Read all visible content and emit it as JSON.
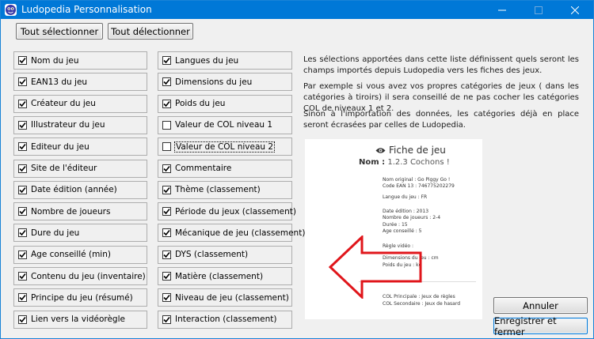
{
  "window": {
    "title": "Ludopedia Personnalisation"
  },
  "toolbar": {
    "select_all": "Tout sélectionner",
    "deselect_all": "Tout délectionner"
  },
  "fields_left": [
    {
      "label": "Nom du jeu",
      "checked": true
    },
    {
      "label": "EAN13 du jeu",
      "checked": true
    },
    {
      "label": "Créateur du jeu",
      "checked": true
    },
    {
      "label": "Illustrateur du jeu",
      "checked": true
    },
    {
      "label": "Editeur du jeu",
      "checked": true
    },
    {
      "label": "Site de l'éditeur",
      "checked": true
    },
    {
      "label": "Date édition (année)",
      "checked": true
    },
    {
      "label": "Nombre de joueurs",
      "checked": true
    },
    {
      "label": "Dure du jeu",
      "checked": true
    },
    {
      "label": "Age conseillé (min)",
      "checked": true
    },
    {
      "label": "Contenu du jeu (inventaire)",
      "checked": true
    },
    {
      "label": "Principe du jeu (résumé)",
      "checked": true
    },
    {
      "label": "Lien vers la vidéorègle",
      "checked": true
    }
  ],
  "fields_right": [
    {
      "label": "Langues du jeu",
      "checked": true
    },
    {
      "label": "Dimensions du jeu",
      "checked": true
    },
    {
      "label": "Poids du jeu",
      "checked": true
    },
    {
      "label": "Valeur de COL niveau 1",
      "checked": false
    },
    {
      "label": "Valeur de COL niveau 2",
      "checked": false
    },
    {
      "label": "Commentaire",
      "checked": true
    },
    {
      "label": "Thème (classement)",
      "checked": true
    },
    {
      "label": "Période du jeux (classement)",
      "checked": true
    },
    {
      "label": "Mécanique de jeu (classement)",
      "checked": true
    },
    {
      "label": "DYS (classement)",
      "checked": true
    },
    {
      "label": "Matière (classement)",
      "checked": true
    },
    {
      "label": "Niveau de jeu (classement)",
      "checked": true
    },
    {
      "label": "Interaction (classement)",
      "checked": true
    }
  ],
  "description": {
    "p1": "Les sélections apportées dans cette liste définissent quels seront les champs importés depuis Ludopedia vers les fiches des jeux.",
    "p2": "Par exemple si vous avez vos propres catégories de jeux ( dans les catégories à tiroirs) il sera conseillé de ne pas cocher les catégories COL de niveaux 1 et 2.",
    "p3": "Sinon à l'importation des données, les catégories déjà en place seront écrasées par celles de Ludopedia."
  },
  "preview": {
    "heading": "Fiche de jeu",
    "name_label": "Nom :",
    "name_value": "1.2.3 Cochons !",
    "lines": [
      "Nom original : Go Piggy Go !",
      "Code EAN 13 : 746775202279",
      "Langue du jeu : FR",
      "Date édition : 2013",
      "Nombre de joueurs : 2-4",
      "Durée : 15",
      "Age conseillé : 5",
      "Règle vidéo :",
      "Dimensions du jeu : cm",
      "Poids du jeu : kg",
      "COL Principale : Jeux de règles",
      "COL Secondaire : Jeux de hasard"
    ]
  },
  "actions": {
    "cancel": "Annuler",
    "save": "Enregistrer et fermer"
  },
  "colors": {
    "titlebar": "#0078d7",
    "arrow": "#e0161b"
  }
}
